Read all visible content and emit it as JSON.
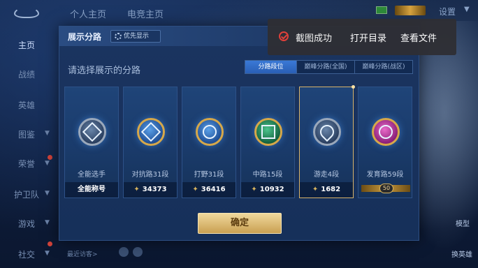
{
  "topbar": {
    "tabs": [
      "个人主页",
      "电竞主页"
    ],
    "settings_label": "设置"
  },
  "leftnav": {
    "items": [
      {
        "label": "主页",
        "active": true
      },
      {
        "label": "战绩"
      },
      {
        "label": "英雄"
      },
      {
        "label": "图鉴"
      },
      {
        "label": "荣誉"
      },
      {
        "label": "护卫队"
      },
      {
        "label": "游戏"
      },
      {
        "label": "社交"
      }
    ]
  },
  "footer": {
    "visitors_label": "最近访客>"
  },
  "right_buttons": {
    "model": "模型",
    "change_hero": "换英雄"
  },
  "dialog": {
    "title": "展示分路",
    "priority_button": "优先显示",
    "prompt": "请选择展示的分路",
    "tabs": [
      {
        "label": "分路段位",
        "active": true
      },
      {
        "label": "巅峰分路(全国)"
      },
      {
        "label": "巅峰分路(战区)"
      }
    ],
    "cards": [
      {
        "name": "全能选手",
        "footer": "全能称号",
        "icon": "all-round-emblem-icon"
      },
      {
        "name": "对抗路31段",
        "score": "34373",
        "icon": "clash-lane-emblem-icon"
      },
      {
        "name": "打野31段",
        "score": "36416",
        "icon": "jungle-emblem-icon"
      },
      {
        "name": "中路15段",
        "score": "10932",
        "icon": "mid-lane-emblem-icon"
      },
      {
        "name": "游走4段",
        "score": "1682",
        "icon": "roam-emblem-icon",
        "selected": true
      },
      {
        "name": "发育路59段",
        "level": "50",
        "icon": "farm-lane-emblem-icon"
      }
    ],
    "confirm": "确定"
  },
  "toast": {
    "message": "截图成功",
    "open_folder": "打开目录",
    "view_file": "查看文件"
  },
  "colors": {
    "dialog_bg": "#1b3460",
    "accent_gold": "#d8b45e",
    "tab_active": "#3a79d6",
    "toast_icon": "#e0403a"
  }
}
